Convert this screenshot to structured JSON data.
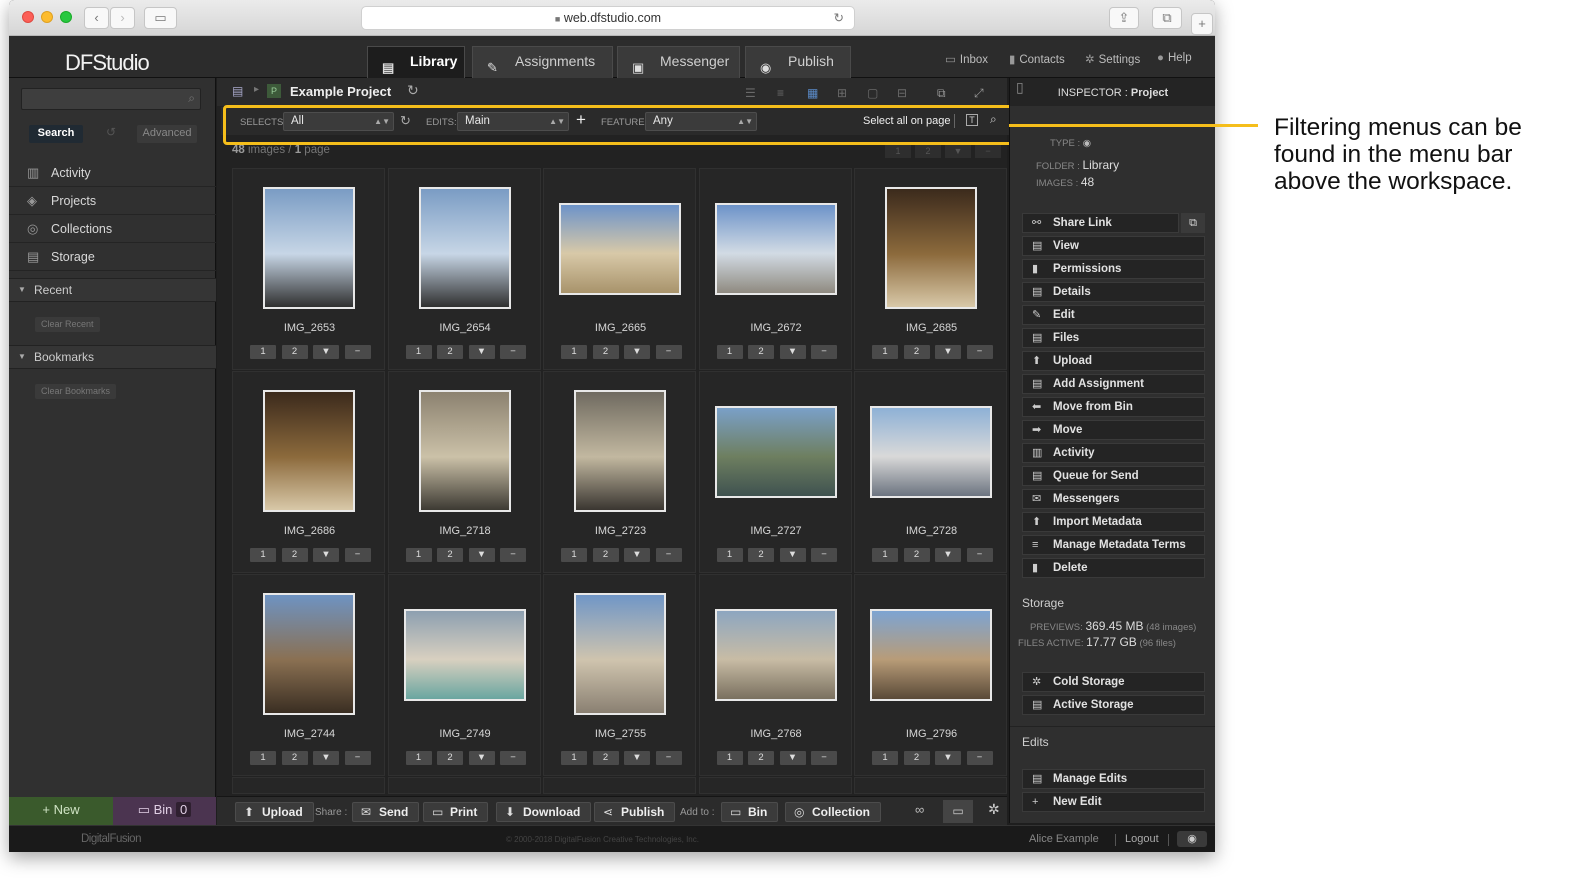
{
  "browser": {
    "url": "web.dfstudio.com"
  },
  "app": {
    "logo": "DFStudio",
    "tabs": [
      {
        "label": "Library",
        "active": true
      },
      {
        "label": "Assignments",
        "active": false
      },
      {
        "label": "Messenger",
        "active": false
      },
      {
        "label": "Publish",
        "active": false
      }
    ],
    "top_links": [
      "Inbox",
      "Contacts",
      "Settings",
      "Help"
    ]
  },
  "sidebar": {
    "search_button": "Search",
    "advanced_button": "Advanced",
    "nav": [
      "Activity",
      "Projects",
      "Collections",
      "Storage"
    ],
    "recent_header": "Recent",
    "clear_recent": "Clear Recent",
    "bookmarks_header": "Bookmarks",
    "clear_bookmarks": "Clear Bookmarks",
    "new_button": "New",
    "bin_button": "Bin",
    "bin_count": "0"
  },
  "workspace": {
    "breadcrumb_badge": "P",
    "project_title": "Example Project",
    "filters": {
      "selects_label": "SELECTS:",
      "selects_value": "All",
      "edits_label": "EDITS:",
      "edits_value": "Main",
      "feature_label": "FEATURE:",
      "feature_value": "Any",
      "select_all": "Select all on page"
    },
    "count_images": "48",
    "count_images_label": "images",
    "count_sep": "/",
    "count_pages": "1",
    "count_pages_label": "page",
    "pager": [
      "1",
      "2"
    ],
    "cell_buttons": [
      "1",
      "2"
    ],
    "images": [
      "IMG_2653",
      "IMG_2654",
      "IMG_2665",
      "IMG_2672",
      "IMG_2685",
      "IMG_2686",
      "IMG_2718",
      "IMG_2723",
      "IMG_2727",
      "IMG_2728",
      "IMG_2744",
      "IMG_2749",
      "IMG_2755",
      "IMG_2768",
      "IMG_2796"
    ]
  },
  "bottombar": {
    "upload": "Upload",
    "share_label": "Share :",
    "send": "Send",
    "print": "Print",
    "download": "Download",
    "publish": "Publish",
    "add_to_label": "Add to :",
    "bin": "Bin",
    "collection": "Collection"
  },
  "inspector": {
    "header_prefix": "INSPECTOR :",
    "header_value": "Project",
    "type_label": "TYPE :",
    "folder_label": "FOLDER :",
    "folder_value": "Library",
    "images_label": "IMAGES :",
    "images_value": "48",
    "actions": [
      "Share Link",
      "View",
      "Permissions",
      "Details",
      "Edit",
      "Files",
      "Upload",
      "Add Assignment",
      "Move from Bin",
      "Move",
      "Activity",
      "Queue for Send",
      "Messengers",
      "Import Metadata",
      "Manage Metadata Terms",
      "Delete"
    ],
    "storage_title": "Storage",
    "previews_label": "PREVIEWS:",
    "previews_value": "369.45 MB",
    "previews_note": "(48 images)",
    "files_label": "FILES ACTIVE:",
    "files_value": "17.77 GB",
    "files_note": "(96 files)",
    "storage_actions": [
      "Cold Storage",
      "Active Storage"
    ],
    "edits_title": "Edits",
    "edits_actions": [
      "Manage Edits",
      "New Edit"
    ]
  },
  "footer": {
    "brand": "DigitalFusion",
    "copyright": "© 2000-2018 DigitalFusion Creative Technologies, Inc.",
    "user": "Alice Example",
    "logout": "Logout"
  },
  "callout": {
    "text": "Filtering menus can be found in the menu bar above the workspace."
  },
  "colors": {
    "highlight": "#f5be1b",
    "new_button_bg": "#3a5a2c",
    "bin_button_bg": "#4b3450"
  }
}
